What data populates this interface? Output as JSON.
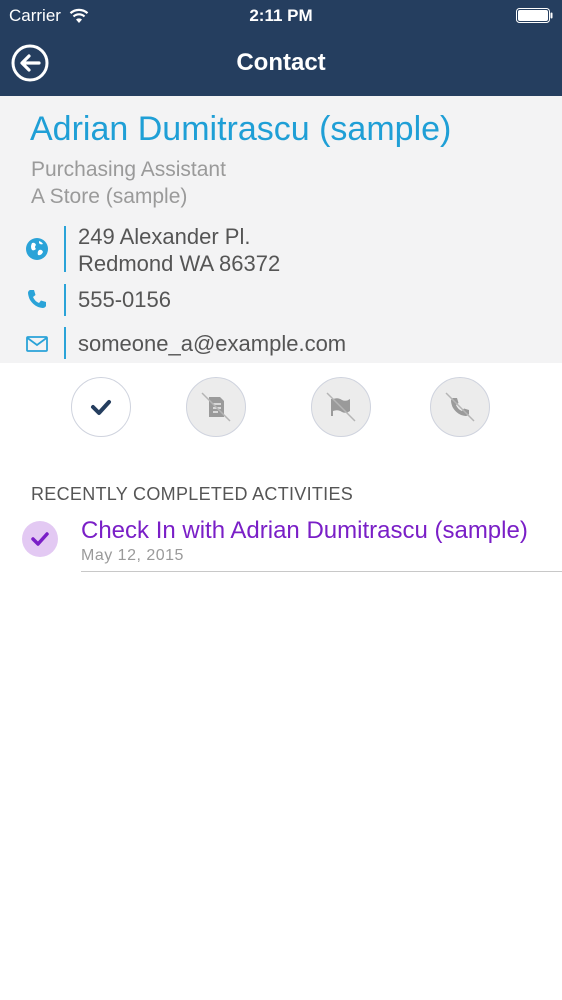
{
  "status_bar": {
    "carrier": "Carrier",
    "time": "2:11 PM",
    "wifi_icon": "wifi-icon",
    "battery_icon": "battery-icon"
  },
  "nav": {
    "title": "Contact",
    "back_icon": "back-arrow-icon"
  },
  "contact": {
    "name": "Adrian Dumitrascu (sample)",
    "title": "Purchasing Assistant",
    "company": "A Store (sample)",
    "address_line1": "249 Alexander Pl.",
    "address_line2": "Redmond WA 86372",
    "phone": "555-0156",
    "email": "someone_a@example.com",
    "address_icon": "globe-icon",
    "phone_icon": "phone-icon",
    "email_icon": "mail-icon"
  },
  "actions": [
    {
      "name": "check-in",
      "icon": "checkmark-icon",
      "enabled": true
    },
    {
      "name": "note",
      "icon": "note-disabled-icon",
      "enabled": false
    },
    {
      "name": "flag",
      "icon": "flag-disabled-icon",
      "enabled": false
    },
    {
      "name": "call",
      "icon": "phone-disabled-icon",
      "enabled": false
    }
  ],
  "recent": {
    "section_title": "RECENTLY COMPLETED ACTIVITIES",
    "items": [
      {
        "title": "Check In with Adrian Dumitrascu (sample)",
        "date": "May 12, 2015",
        "icon": "checkmark-icon"
      }
    ]
  },
  "colors": {
    "header_bg": "#253e5f",
    "accent_blue": "#1f9fd6",
    "activity_purple": "#7a1fc7",
    "activity_check_bg": "#e3c9f3"
  }
}
